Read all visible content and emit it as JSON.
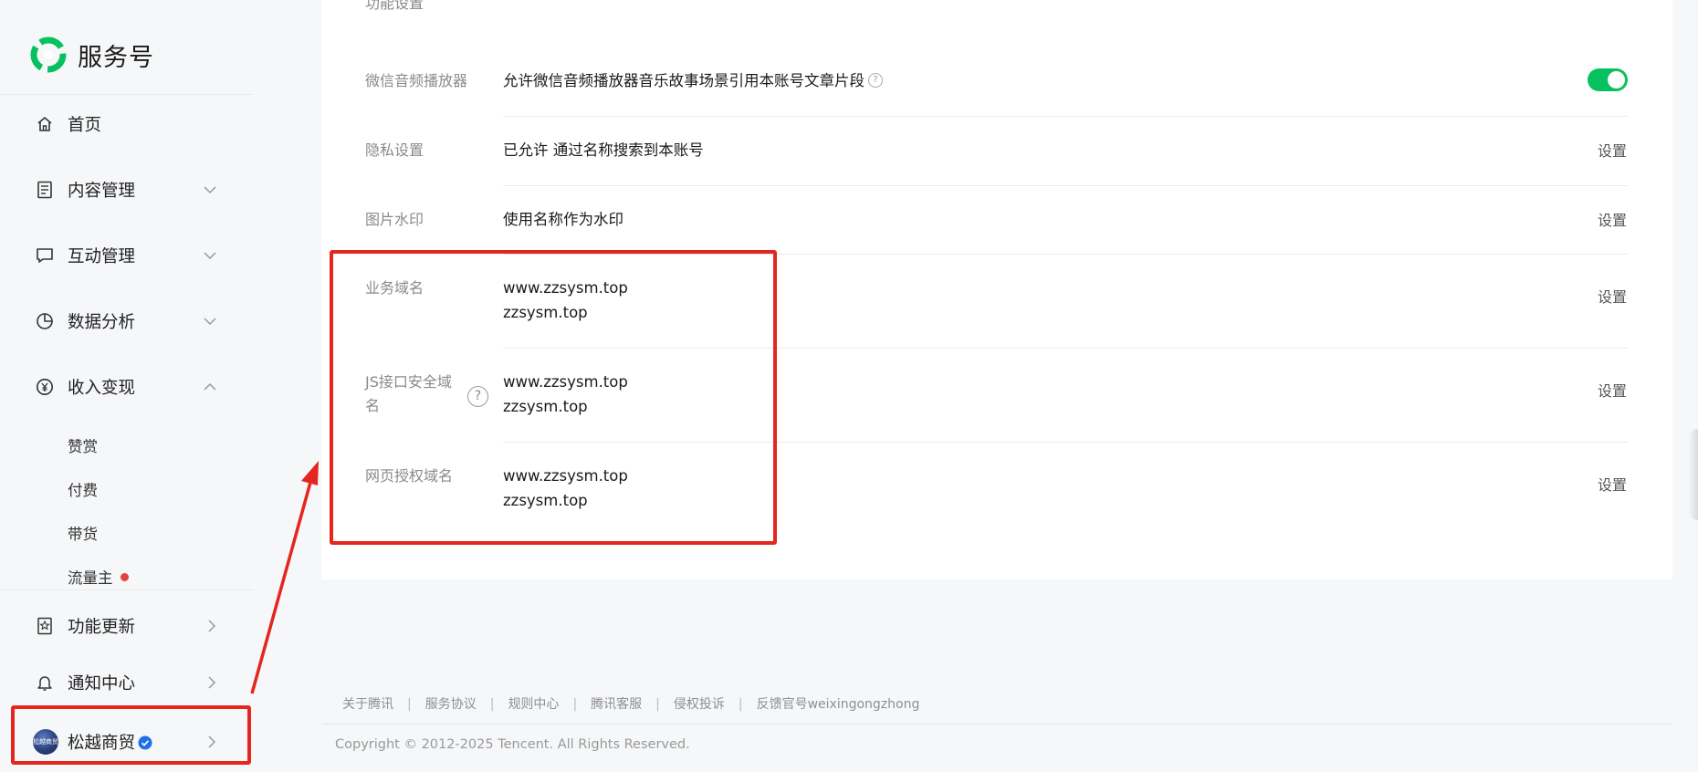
{
  "app": {
    "title": "服务号"
  },
  "sidebar": {
    "items": [
      {
        "label": "首页",
        "icon": "home-icon"
      },
      {
        "label": "内容管理",
        "icon": "document-icon",
        "arrow": "chevron-down"
      },
      {
        "label": "互动管理",
        "icon": "chat-icon",
        "arrow": "chevron-down"
      },
      {
        "label": "数据分析",
        "icon": "pie-chart-icon",
        "arrow": "chevron-down"
      },
      {
        "label": "收入变现",
        "icon": "yen-icon",
        "arrow": "chevron-up"
      }
    ],
    "sub_items": [
      "赞赏",
      "付费",
      "带货",
      "流量主"
    ],
    "bottom_items": [
      {
        "label": "功能更新",
        "icon": "update-icon"
      },
      {
        "label": "通知中心",
        "icon": "bell-icon"
      }
    ],
    "account": {
      "name": "松越商贸",
      "avatar_text": "松越商贸",
      "verified": true
    }
  },
  "settings": {
    "cut_off_heading": "功能设置",
    "rows": [
      {
        "label": "微信音频播放器",
        "value": "允许微信音频播放器音乐故事场景引用本账号文章片段",
        "control": "toggle-on"
      },
      {
        "label": "隐私设置",
        "value": "已允许 通过名称搜索到本账号",
        "action": "设置"
      },
      {
        "label": "图片水印",
        "value": "使用名称作为水印",
        "action": "设置"
      },
      {
        "label": "业务域名",
        "values": [
          "www.zzsysm.top",
          "zzsysm.top"
        ],
        "action": "设置"
      },
      {
        "label": "JS接口安全域名",
        "values": [
          "www.zzsysm.top",
          "zzsysm.top"
        ],
        "action": "设置"
      },
      {
        "label": "网页授权域名",
        "values": [
          "www.zzsysm.top",
          "zzsysm.top"
        ],
        "action": "设置"
      }
    ]
  },
  "footer": {
    "links": [
      "关于腾讯",
      "服务协议",
      "规则中心",
      "腾讯客服",
      "侵权投诉",
      "反馈官号weixingongzhong"
    ],
    "copyright": "Copyright © 2012-2025 Tencent. All Rights Reserved."
  },
  "colors": {
    "accent": "#07c160",
    "annotation": "#e5261f",
    "badge_dot": "#e2433a",
    "verified": "#1e6fe8"
  }
}
